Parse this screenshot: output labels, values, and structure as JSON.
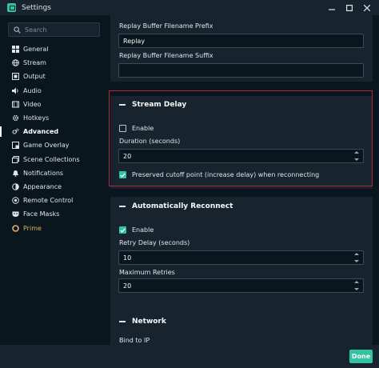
{
  "window": {
    "title": "Settings"
  },
  "search": {
    "placeholder": "Search"
  },
  "sidebar": {
    "items": [
      {
        "label": "General",
        "icon": "gear-grid-icon"
      },
      {
        "label": "Stream",
        "icon": "globe-icon"
      },
      {
        "label": "Output",
        "icon": "output-icon"
      },
      {
        "label": "Audio",
        "icon": "speaker-icon"
      },
      {
        "label": "Video",
        "icon": "film-icon"
      },
      {
        "label": "Hotkeys",
        "icon": "gear-icon"
      },
      {
        "label": "Advanced",
        "icon": "cogs-icon"
      },
      {
        "label": "Game Overlay",
        "icon": "overlay-icon"
      },
      {
        "label": "Scene Collections",
        "icon": "collections-icon"
      },
      {
        "label": "Notifications",
        "icon": "bell-icon"
      },
      {
        "label": "Appearance",
        "icon": "appearance-icon"
      },
      {
        "label": "Remote Control",
        "icon": "remote-icon"
      },
      {
        "label": "Face Masks",
        "icon": "mask-icon"
      },
      {
        "label": "Prime",
        "icon": "prime-icon"
      }
    ],
    "active": "Advanced"
  },
  "replay": {
    "prefix_label": "Replay Buffer Filename Prefix",
    "prefix_value": "Replay",
    "suffix_label": "Replay Buffer Filename Suffix",
    "suffix_value": ""
  },
  "stream_delay": {
    "title": "Stream Delay",
    "enable_label": "Enable",
    "enable_checked": false,
    "duration_label": "Duration (seconds)",
    "duration_value": "20",
    "preserve_label": "Preserved cutoff point (increase delay) when reconnecting",
    "preserve_checked": true
  },
  "auto_reconnect": {
    "title": "Automatically Reconnect",
    "enable_label": "Enable",
    "enable_checked": true,
    "retry_label": "Retry Delay (seconds)",
    "retry_value": "10",
    "max_label": "Maximum Retries",
    "max_value": "20"
  },
  "network": {
    "title": "Network",
    "bind_label": "Bind to IP"
  },
  "footer": {
    "done_label": "Done"
  },
  "colors": {
    "accent": "#31c3a2",
    "highlight": "#b52a3a",
    "prime": "#e0b360",
    "panel": "#17242d",
    "background": "#09161d"
  }
}
